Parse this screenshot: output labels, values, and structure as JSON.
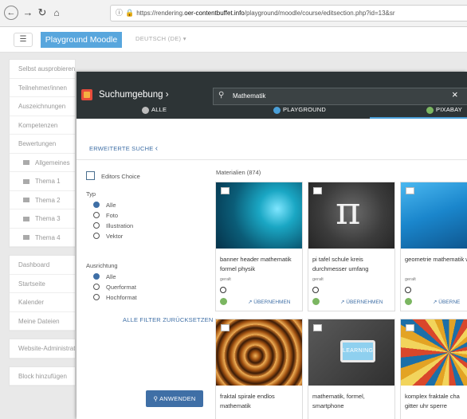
{
  "browser": {
    "url_prefix": "https://rendering.",
    "url_domain": "oer-contentbuffet.info",
    "url_path": "/playground/moodle/course/editsection.php?id=13&sr"
  },
  "moodle": {
    "brand": "Playground Moodle",
    "language": "DEUTSCH (DE)",
    "sidebar_group1": [
      "Selbst ausprobieren",
      "Teilnehmer/innen",
      "Auszeichnungen",
      "Kompetenzen",
      "Bewertungen",
      "Allgemeines",
      "Thema 1",
      "Thema 2",
      "Thema 3",
      "Thema 4"
    ],
    "sidebar_group2": [
      "Dashboard",
      "Startseite",
      "Kalender",
      "Meine Dateien"
    ],
    "sidebar_group3": [
      "Website-Administration"
    ],
    "sidebar_group4": [
      "Block hinzufügen"
    ]
  },
  "modal": {
    "title": "Suchumgebung",
    "search_value": "Mathematik",
    "tabs": [
      {
        "label": "ALLE",
        "color": "#bdbdbd"
      },
      {
        "label": "PLAYGROUND",
        "color": "#4a9fd8"
      },
      {
        "label": "PIXABAY",
        "color": "#7bb661"
      }
    ],
    "advanced_search": "ERWEITERTE SUCHE",
    "editors_choice": "Editors Choice",
    "type_label": "Typ",
    "type_options": [
      "Alle",
      "Foto",
      "Illustration",
      "Vektor"
    ],
    "orientation_label": "Ausrichtung",
    "orientation_options": [
      "Alle",
      "Querformat",
      "Hochformat"
    ],
    "reset_filters": "ALLE FILTER ZURÜCKSETZEN",
    "apply": "ANWENDEN",
    "materials_label": "Materialien (874)",
    "cards": [
      {
        "title": "banner header mathematik formel physik",
        "author": "geralt",
        "action": "ÜBERNEHMEN"
      },
      {
        "title": "pi tafel schule kreis durchmesser umfang",
        "author": "geralt",
        "action": "ÜBERNEHMEN"
      },
      {
        "title": "geometrie mathematik würfel hexaeder kub",
        "author": "geralt",
        "action": "ÜBERNE"
      },
      {
        "title": "fraktal spirale endlos mathematik",
        "author": "",
        "action": ""
      },
      {
        "title": "mathematik, formel, smartphone",
        "author": "",
        "action": ""
      },
      {
        "title": "komplex fraktale cha gitter uhr sperre",
        "author": "",
        "action": ""
      }
    ],
    "card2_overlay": "LEARNING"
  }
}
